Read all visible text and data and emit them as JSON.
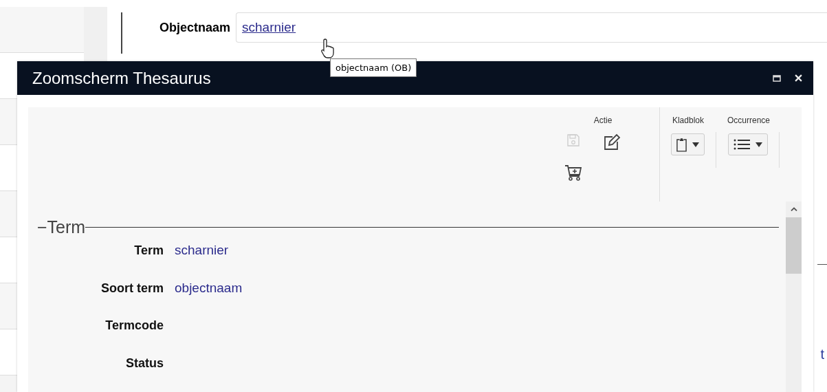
{
  "page": {
    "field": {
      "label": "Objectnaam",
      "value": "scharnier"
    },
    "tooltip": "objectnaam (OB)",
    "partial_text": "t"
  },
  "dialog": {
    "title": "Zoomscherm Thesaurus",
    "toolbar": [
      {
        "label": "Actie",
        "kind": "actions",
        "buttons": [
          {
            "kind": "save",
            "disabled": true
          },
          {
            "kind": "edit",
            "disabled": false
          },
          {
            "kind": "cart",
            "disabled": false
          }
        ]
      },
      {
        "label": "Kladblok",
        "kind": "dropdown",
        "buttons": [
          {
            "kind": "clipboard",
            "disabled": false
          }
        ]
      },
      {
        "label": "Occurrence",
        "kind": "dropdown",
        "buttons": [
          {
            "kind": "list",
            "disabled": false
          }
        ]
      }
    ],
    "section": {
      "title": "−Term",
      "fields": [
        {
          "label": "Term",
          "value": "scharnier"
        },
        {
          "label": "Soort term",
          "value": "objectnaam"
        },
        {
          "label": "Termcode"
        },
        {
          "label": "Status"
        }
      ]
    }
  }
}
